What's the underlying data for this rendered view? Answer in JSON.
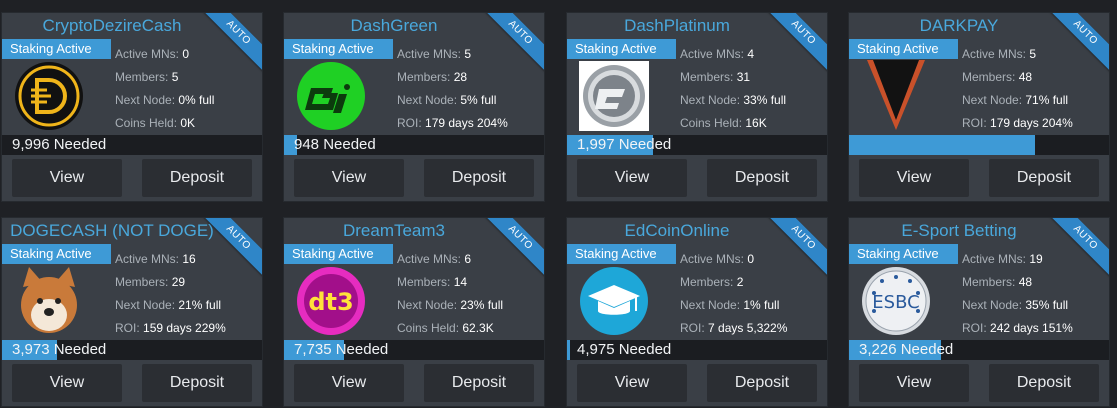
{
  "cards": [
    {
      "name": "CryptoDezireCash",
      "ribbon": "AUTO",
      "staking": "Staking Active",
      "stats": [
        {
          "label": "Active MNs: ",
          "value": "0"
        },
        {
          "label": "Members: ",
          "value": "5"
        },
        {
          "label": "Next Node: ",
          "value": "0% full"
        },
        {
          "label": "Coins Held: ",
          "value": "0K"
        }
      ],
      "needed": "9,996 Needed",
      "progress": 0.0,
      "view": "View",
      "deposit": "Deposit",
      "logo": "cryptodezire-logo"
    },
    {
      "name": "DashGreen",
      "ribbon": "AUTO",
      "staking": "Staking Active",
      "stats": [
        {
          "label": "Active MNs: ",
          "value": "5"
        },
        {
          "label": "Members: ",
          "value": "28"
        },
        {
          "label": "Next Node: ",
          "value": "5% full"
        },
        {
          "label": "ROI: ",
          "value": "179 days   204%"
        }
      ],
      "needed": "948 Needed",
      "progress": 0.05,
      "view": "View",
      "deposit": "Deposit",
      "logo": "dashgreen-logo"
    },
    {
      "name": "DashPlatinum",
      "ribbon": "AUTO",
      "staking": "Staking Active",
      "stats": [
        {
          "label": "Active MNs: ",
          "value": "4"
        },
        {
          "label": "Members: ",
          "value": "31"
        },
        {
          "label": "Next Node: ",
          "value": "33% full"
        },
        {
          "label": "Coins Held: ",
          "value": "16K"
        }
      ],
      "needed": "1,997 Needed",
      "progress": 0.33,
      "view": "View",
      "deposit": "Deposit",
      "logo": "dashplatinum-logo"
    },
    {
      "name": "DARKPAY",
      "ribbon": "AUTO",
      "staking": "Staking Active",
      "stats": [
        {
          "label": "Active MNs: ",
          "value": "5"
        },
        {
          "label": "Members: ",
          "value": "48"
        },
        {
          "label": "Next Node: ",
          "value": "71% full"
        },
        {
          "label": "ROI: ",
          "value": "179 days   204%"
        }
      ],
      "needed": "",
      "progress": 0.71,
      "view": "View",
      "deposit": "Deposit",
      "logo": "darkpay-logo"
    },
    {
      "name": "DOGECASH (NOT DOGE)",
      "ribbon": "AUTO",
      "staking": "Staking Active",
      "stats": [
        {
          "label": "Active MNs: ",
          "value": "16"
        },
        {
          "label": "Members: ",
          "value": "29"
        },
        {
          "label": "Next Node: ",
          "value": "21% full"
        },
        {
          "label": "ROI: ",
          "value": "159 days   229%"
        }
      ],
      "needed": "3,973 Needed",
      "progress": 0.21,
      "view": "View",
      "deposit": "Deposit",
      "logo": "dogecash-logo"
    },
    {
      "name": "DreamTeam3",
      "ribbon": "AUTO",
      "staking": "Staking Active",
      "stats": [
        {
          "label": "Active MNs: ",
          "value": "6"
        },
        {
          "label": "Members: ",
          "value": "14"
        },
        {
          "label": "Next Node: ",
          "value": "23% full"
        },
        {
          "label": "Coins Held: ",
          "value": "62.3K"
        }
      ],
      "needed": "7,735 Needed",
      "progress": 0.23,
      "view": "View",
      "deposit": "Deposit",
      "logo": "dreamteam3-logo"
    },
    {
      "name": "EdCoinOnline",
      "ribbon": "AUTO",
      "staking": "Staking Active",
      "stats": [
        {
          "label": "Active MNs: ",
          "value": "0"
        },
        {
          "label": "Members: ",
          "value": "2"
        },
        {
          "label": "Next Node: ",
          "value": "1% full"
        },
        {
          "label": "ROI: ",
          "value": "7 days   5,322%"
        }
      ],
      "needed": "4,975 Needed",
      "progress": 0.01,
      "view": "View",
      "deposit": "Deposit",
      "logo": "edcoin-logo"
    },
    {
      "name": "E-Sport Betting",
      "ribbon": "AUTO",
      "staking": "Staking Active",
      "stats": [
        {
          "label": "Active MNs: ",
          "value": "19"
        },
        {
          "label": "Members: ",
          "value": "48"
        },
        {
          "label": "Next Node: ",
          "value": "35% full"
        },
        {
          "label": "ROI: ",
          "value": "242 days   151%"
        }
      ],
      "needed": "3,226 Needed",
      "progress": 0.35,
      "view": "View",
      "deposit": "Deposit",
      "logo": "esbc-logo"
    }
  ]
}
